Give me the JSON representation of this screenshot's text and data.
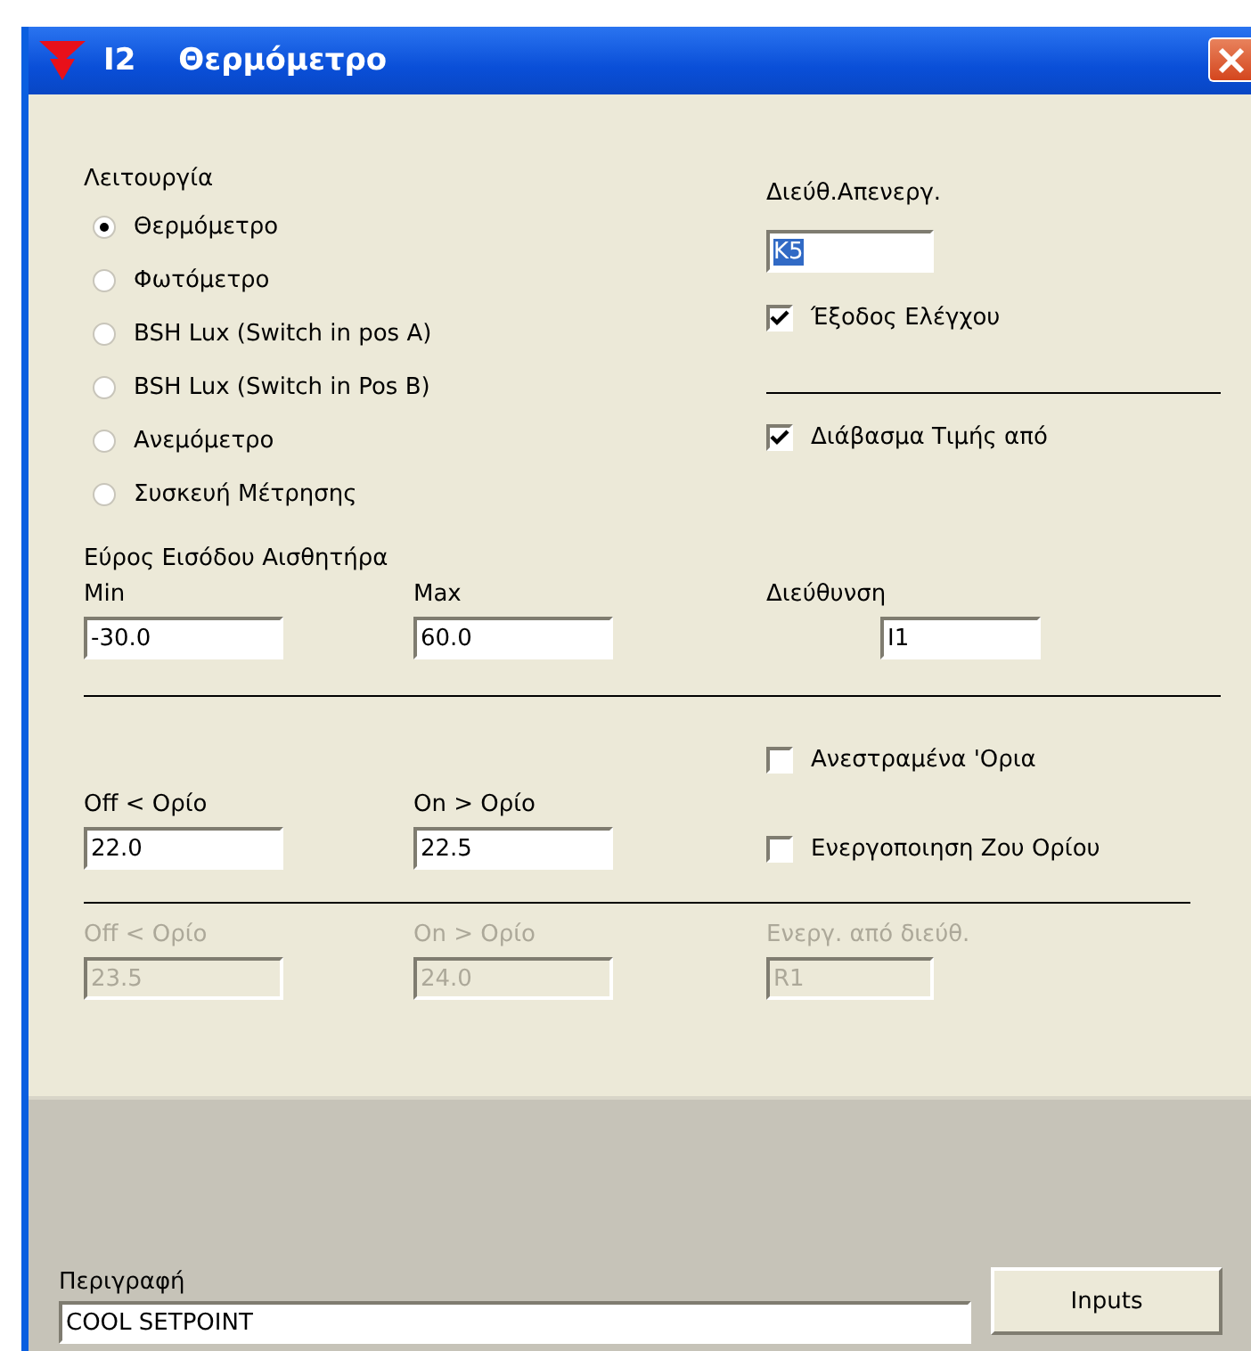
{
  "window": {
    "id": "I2",
    "title": "Θερμόμετρο"
  },
  "mode": {
    "label": "Λειτουργία",
    "options": [
      {
        "label": "Θερμόμετρο",
        "selected": true
      },
      {
        "label": "Φωτόμετρο",
        "selected": false
      },
      {
        "label": "BSH Lux  (Switch in pos A)",
        "selected": false
      },
      {
        "label": "BSH Lux (Switch in Pos B)",
        "selected": false
      },
      {
        "label": "Ανεμόμετρο",
        "selected": false
      },
      {
        "label": "Συσκευή Μέτρησης",
        "selected": false
      }
    ]
  },
  "deactivation_address": {
    "label": "Διεύθ.Απενεργ.",
    "value": "K5",
    "highlighted": true
  },
  "control_output": {
    "label": "Έξοδος Ελέγχου",
    "checked": true
  },
  "read_value_from": {
    "label": "Διάβασμα Τιμής από",
    "checked": true
  },
  "sensor_range": {
    "label": "Εύρος Εισόδου Αισθητήρα",
    "min": {
      "label": "Min",
      "value": "-30.0"
    },
    "max": {
      "label": "Max",
      "value": "60.0"
    }
  },
  "address": {
    "label": "Διεύθυνση",
    "value": "I1"
  },
  "inverted_limits": {
    "label": "Ανεστραμένα 'Ορια",
    "checked": false
  },
  "threshold_rows": [
    {
      "disabled": false,
      "off_label": "Off < Ορίο",
      "off_value": "22.0",
      "on_label": "On > Ορίο",
      "on_value": "22.5",
      "side": {
        "kind": "checkbox",
        "label": "Ενεργοποιηση Ζου Ορίου",
        "checked": false
      }
    },
    {
      "disabled": true,
      "off_label": "Off < Ορίο",
      "off_value": "23.5",
      "on_label": "On > Ορίο",
      "on_value": "24.0",
      "side": {
        "kind": "field",
        "label": "Ενεργ. από διεύθ.",
        "value": "R1"
      }
    }
  ],
  "description": {
    "label": "Περιγραφή",
    "value": "COOL SETPOINT"
  },
  "buttons": [
    "Inputs"
  ]
}
